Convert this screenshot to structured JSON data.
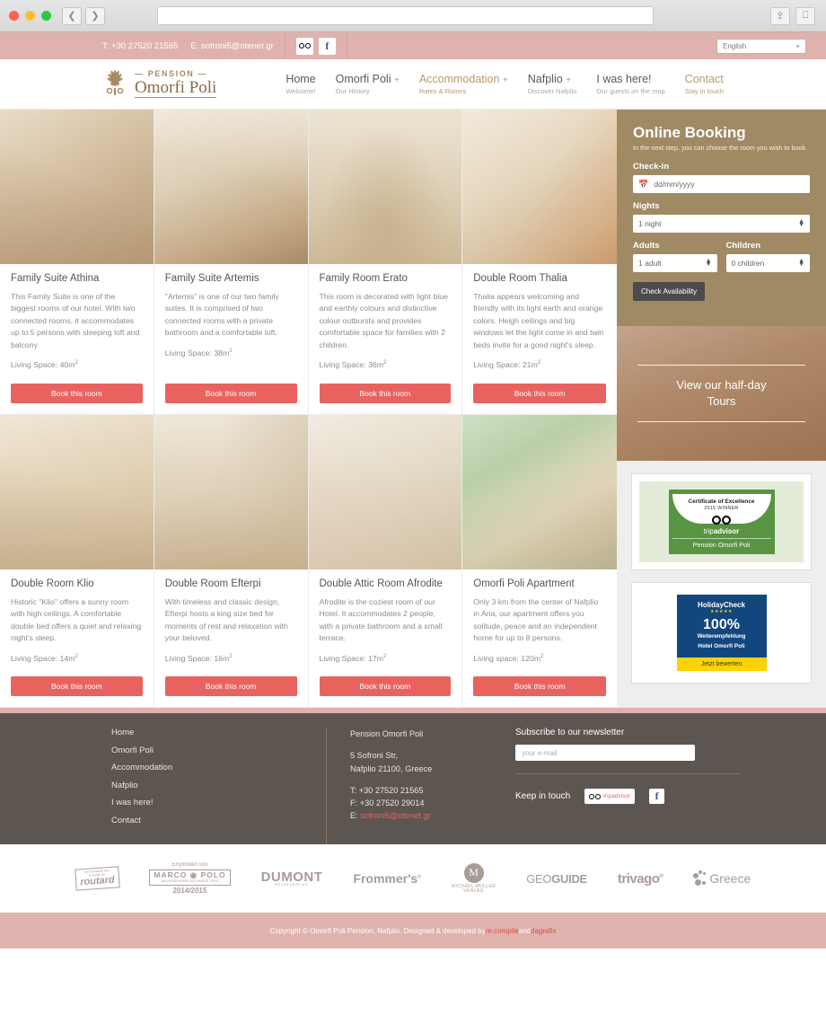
{
  "browser": {
    "back_icon": "chevron-left",
    "forward_icon": "chevron-right",
    "url": "",
    "share_icon": "share",
    "tabs_icon": "tabs"
  },
  "topbar": {
    "phone": "T: +30 27520 21565",
    "email": "E: sofroni5@otenet.gr",
    "tripadvisor_icon": "tripadvisor-icon",
    "facebook_icon": "facebook-icon",
    "language": "English",
    "language_caret": "+"
  },
  "header": {
    "logo_pension": "— PENSION —",
    "logo_name": "Omorfi Poli",
    "nav": [
      {
        "label": "Home",
        "sub": "Welcome!",
        "plus": "",
        "accent": false
      },
      {
        "label": "Omorfi Poli",
        "sub": "Our History",
        "plus": "+",
        "accent": false
      },
      {
        "label": "Accommodation",
        "sub": "Rates & Rooms",
        "plus": "+",
        "accent": true
      },
      {
        "label": "Nafplio",
        "sub": "Discover Nafplio",
        "plus": "+",
        "accent": false
      },
      {
        "label": "I was here!",
        "sub": "Our guests on the map",
        "plus": "",
        "accent": false
      },
      {
        "label": "Contact",
        "sub": "Stay in touch",
        "plus": "",
        "accent": true
      }
    ]
  },
  "rooms": [
    {
      "title": "Family Suite Athina",
      "desc": "This Family Suite is one of the biggest rooms of our hotel. With two connected rooms, it accommodates up to 5 persons with sleeping loft and balcony",
      "space_label": "Living Space: 40m",
      "space_sup": "2",
      "button": "Book this room"
    },
    {
      "title": "Family Suite Artemis",
      "desc": "\"Artemis\" is one of our two family suites. It is comprised of two connected rooms with a private bathroom and a comfortable loft.",
      "space_label": "Living Space: 38m",
      "space_sup": "2",
      "button": "Book this room"
    },
    {
      "title": "Family Room Erato",
      "desc": "This room is decorated with light blue and earthly colours and distinctive colour outbursts and provides comfortable space for families with 2 children.",
      "space_label": "Living Space: 36m",
      "space_sup": "2",
      "button": "Book this room"
    },
    {
      "title": "Double Room Thalia",
      "desc": "Thalia appears welcoming and friendly with its light earth and orange colors. Heigh ceilings and big windows let the light come in and twin beds invite for a good night's sleep.",
      "space_label": "Living Space: 21m",
      "space_sup": "2",
      "button": "Book this room"
    },
    {
      "title": "Double Room Klio",
      "desc": "Historic \"Klio\" offers a sunny room with high ceilings. A comfortable double bed offers a quiet and relaxing night's sleep.",
      "space_label": "Living Space: 14m",
      "space_sup": "2",
      "button": "Book this room"
    },
    {
      "title": "Double Room Efterpi",
      "desc": "With timeless and classic design, Efterpi hosts a king size bed for moments of rest and relaxation with your beloved.",
      "space_label": "Living Space: 16m",
      "space_sup": "2",
      "button": "Book this room"
    },
    {
      "title": "Double Attic Room Afrodite",
      "desc": "Afrodite is the coziest room of our Hotel. It accommodates 2 people, with a private bathroom and a small terrace.",
      "space_label": "Living Space: 17m",
      "space_sup": "2",
      "button": "Book this room"
    },
    {
      "title": "Omorfi Poli Apartment",
      "desc": "Only 3 km from the center of Nafplio in Aria, our apartment offers you solitude, peace and an independent home for up to 8 persons.",
      "space_label": "Living space: 120m",
      "space_sup": "2",
      "button": "Book this room"
    }
  ],
  "booking": {
    "title": "Online Booking",
    "subtitle": "In the next step, you can choose the room you wish to book.",
    "checkin_label": "Check-in",
    "checkin_placeholder": "dd/mm/yyyy",
    "calendar_icon": "calendar-icon",
    "nights_label": "Nights",
    "nights_value": "1 night",
    "adults_label": "Adults",
    "adults_value": "1 adult",
    "children_label": "Children",
    "children_value": "0 children",
    "submit": "Check Availability"
  },
  "tours": {
    "line1": "View our half-day",
    "line2": "Tours"
  },
  "badges": {
    "tripadvisor": {
      "certificate": "Certificate of Excellence",
      "year": "2015 WINNER",
      "brand_light": "trip",
      "brand_bold": "advisor",
      "hotel": "Pension Omorfi Poli"
    },
    "holidaycheck": {
      "brand": "HolidayCheck",
      "stars": "★★★★★",
      "percent": "100%",
      "recommend": "Weiterempfehlung",
      "hotel": "Hotel Omorfi Poli",
      "cta": "Jetzt bewerten"
    }
  },
  "footer": {
    "links": [
      "Home",
      "Omorfi Poli",
      "Accommodation",
      "Nafplio",
      "I was here!",
      "Contact"
    ],
    "address_name": "Pension Omorfi Poli",
    "address_line1": "5 Sofroni Str,",
    "address_line2": "Nafplio 21100, Greece",
    "tel": "T: +30 27520 21565",
    "fax": "F: +30 27520 29014",
    "email_prefix": "E: ",
    "email": "sofroni5@otenet.gr",
    "newsletter_title": "Subscribe to our newsletter",
    "newsletter_placeholder": "your e-mail",
    "keep_in_touch": "Keep in touch",
    "tripadvisor_label_light": "trip",
    "tripadvisor_label_bold": "advisor",
    "facebook_icon": "facebook-icon"
  },
  "partners": [
    {
      "name": "routard",
      "top": "recommandé par",
      "main": "routard",
      "sub": "le Guide du"
    },
    {
      "name": "marco-polo",
      "top": "Empfohlen von",
      "main": "MARCO ◉ POLO",
      "small": "DIE REISEFÜHRER MIT INSIDER-TIPPS",
      "year": "2014/2015"
    },
    {
      "name": "dumont",
      "main": "DUMONT",
      "sub": "REISEVERLAG"
    },
    {
      "name": "frommers",
      "main": "Frommer's",
      "sup": "®"
    },
    {
      "name": "michael-muller-verlag",
      "main": "MICHAEL MÜLLER",
      "sub": "VERLAG"
    },
    {
      "name": "geoguide",
      "light": "GEO",
      "bold": "GUIDE"
    },
    {
      "name": "trivago",
      "main": "trivago",
      "sup": "®"
    },
    {
      "name": "greece",
      "main": "Greece"
    }
  ],
  "copyright": {
    "text_before": "Copyright © Omorfi Poli Pension, Nafplio. Designed & developed by ",
    "link1": "re.compile",
    "text_middle": " and ",
    "link2": "dagrafix"
  },
  "colors": {
    "accent_pink": "#e0b2ae",
    "accent_gold": "#a08a64",
    "accent_coral": "#e8635f",
    "footer_dark": "#5d5550"
  }
}
